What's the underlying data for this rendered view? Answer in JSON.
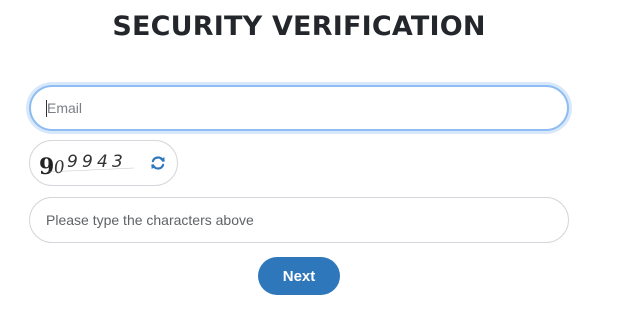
{
  "page": {
    "title": "SECURITY VERIFICATION"
  },
  "form": {
    "email": {
      "value": "",
      "placeholder": "Email"
    },
    "captcha": {
      "characters": "909943",
      "refresh_icon": "refresh-icon"
    },
    "captcha_input": {
      "value": "",
      "placeholder": "Please type the characters above"
    },
    "next_label": "Next"
  },
  "colors": {
    "title": "#23272b",
    "focus_border": "#8fbdf3",
    "field_border": "#d4d7db",
    "button_bg": "#2f77bb",
    "button_text": "#ffffff",
    "refresh_icon": "#2f77bb"
  }
}
